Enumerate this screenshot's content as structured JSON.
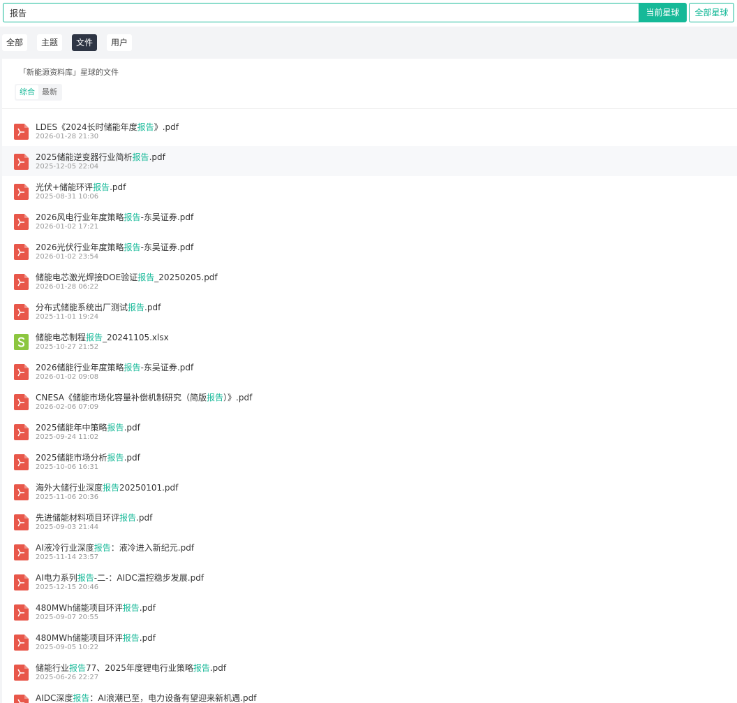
{
  "search": {
    "value": "报告",
    "placeholder": ""
  },
  "buttons": {
    "current_planet": "当前星球",
    "all_planets": "全部星球"
  },
  "tabs": [
    {
      "label": "全部",
      "active": false
    },
    {
      "label": "主题",
      "active": false
    },
    {
      "label": "文件",
      "active": true
    },
    {
      "label": "用户",
      "active": false
    }
  ],
  "panel": {
    "title": "「新能源资料库」星球的文件",
    "sort": [
      {
        "label": "综合",
        "active": true
      },
      {
        "label": "最新",
        "active": false
      }
    ]
  },
  "colors": {
    "accent": "#16b998",
    "pdf_icon": "#e8574a",
    "xlsx_icon": "#8cc63f",
    "active_tab": "#2e3544"
  },
  "files": [
    {
      "icon": "pdf-icon",
      "pre": "LDES《2024长时储能年度",
      "hl": "报告",
      "post": "》.pdf",
      "date": "2026-01-28 21:30"
    },
    {
      "icon": "pdf-icon",
      "pre": "2025储能逆变器行业简析",
      "hl": "报告",
      "post": ".pdf",
      "date": "2025-12-05 22:04"
    },
    {
      "icon": "pdf-icon",
      "pre": "光伏+储能环评",
      "hl": "报告",
      "post": ".pdf",
      "date": "2025-08-31 10:06"
    },
    {
      "icon": "pdf-icon",
      "pre": "2026风电行业年度策略",
      "hl": "报告",
      "post": "-东吴证券.pdf",
      "date": "2026-01-02 17:21"
    },
    {
      "icon": "pdf-icon",
      "pre": "2026光伏行业年度策略",
      "hl": "报告",
      "post": "-东吴证券.pdf",
      "date": "2026-01-02 23:54"
    },
    {
      "icon": "pdf-icon",
      "pre": "储能电芯激光焊接DOE验证",
      "hl": "报告",
      "post": "_20250205.pdf",
      "date": "2026-01-28 06:22"
    },
    {
      "icon": "pdf-icon",
      "pre": "分布式储能系统出厂测试",
      "hl": "报告",
      "post": ".pdf",
      "date": "2025-11-01 19:24"
    },
    {
      "icon": "xlsx-icon",
      "pre": "储能电芯制程",
      "hl": "报告",
      "post": "_20241105.xlsx",
      "date": "2025-10-27 21:52"
    },
    {
      "icon": "pdf-icon",
      "pre": "2026储能行业年度策略",
      "hl": "报告",
      "post": "-东吴证券.pdf",
      "date": "2026-01-02 09:08"
    },
    {
      "icon": "pdf-icon",
      "pre": "CNESA《储能市场化容量补偿机制研究（简版",
      "hl": "报告",
      "post": "）》.pdf",
      "date": "2026-02-06 07:09"
    },
    {
      "icon": "pdf-icon",
      "pre": "2025储能年中策略",
      "hl": "报告",
      "post": ".pdf",
      "date": "2025-09-24 11:02"
    },
    {
      "icon": "pdf-icon",
      "pre": "2025储能市场分析",
      "hl": "报告",
      "post": ".pdf",
      "date": "2025-10-06 16:31"
    },
    {
      "icon": "pdf-icon",
      "pre": "海外大储行业深度",
      "hl": "报告",
      "post": "20250101.pdf",
      "date": "2025-11-06 20:36"
    },
    {
      "icon": "pdf-icon",
      "pre": "先进储能材料项目环评",
      "hl": "报告",
      "post": ".pdf",
      "date": "2025-09-03 21:44"
    },
    {
      "icon": "pdf-icon",
      "pre": "AI液冷行业深度",
      "hl": "报告",
      "post": "：液冷进入新纪元.pdf",
      "date": "2025-11-14 23:57"
    },
    {
      "icon": "pdf-icon",
      "pre": "AI电力系列",
      "hl": "报告",
      "post": "-二-：AIDC温控稳步发展.pdf",
      "date": "2025-12-15 20:46"
    },
    {
      "icon": "pdf-icon",
      "pre": "480MWh储能项目环评",
      "hl": "报告",
      "post": ".pdf",
      "date": "2025-09-07 20:55"
    },
    {
      "icon": "pdf-icon",
      "pre": "480MWh储能项目环评",
      "hl": "报告",
      "post": ".pdf",
      "date": "2025-09-05 10:22"
    },
    {
      "icon": "pdf-icon",
      "pre": "储能行业",
      "hl": "报告",
      "post": "77、2025年度锂电行业策略",
      "hl2": "报告",
      "post2": ".pdf",
      "date": "2025-06-26 22:27"
    },
    {
      "icon": "pdf-icon",
      "pre": "AIDC深度",
      "hl": "报告",
      "post": "：AI浪潮已至，电力设备有望迎来新机遇.pdf",
      "date": ""
    }
  ]
}
